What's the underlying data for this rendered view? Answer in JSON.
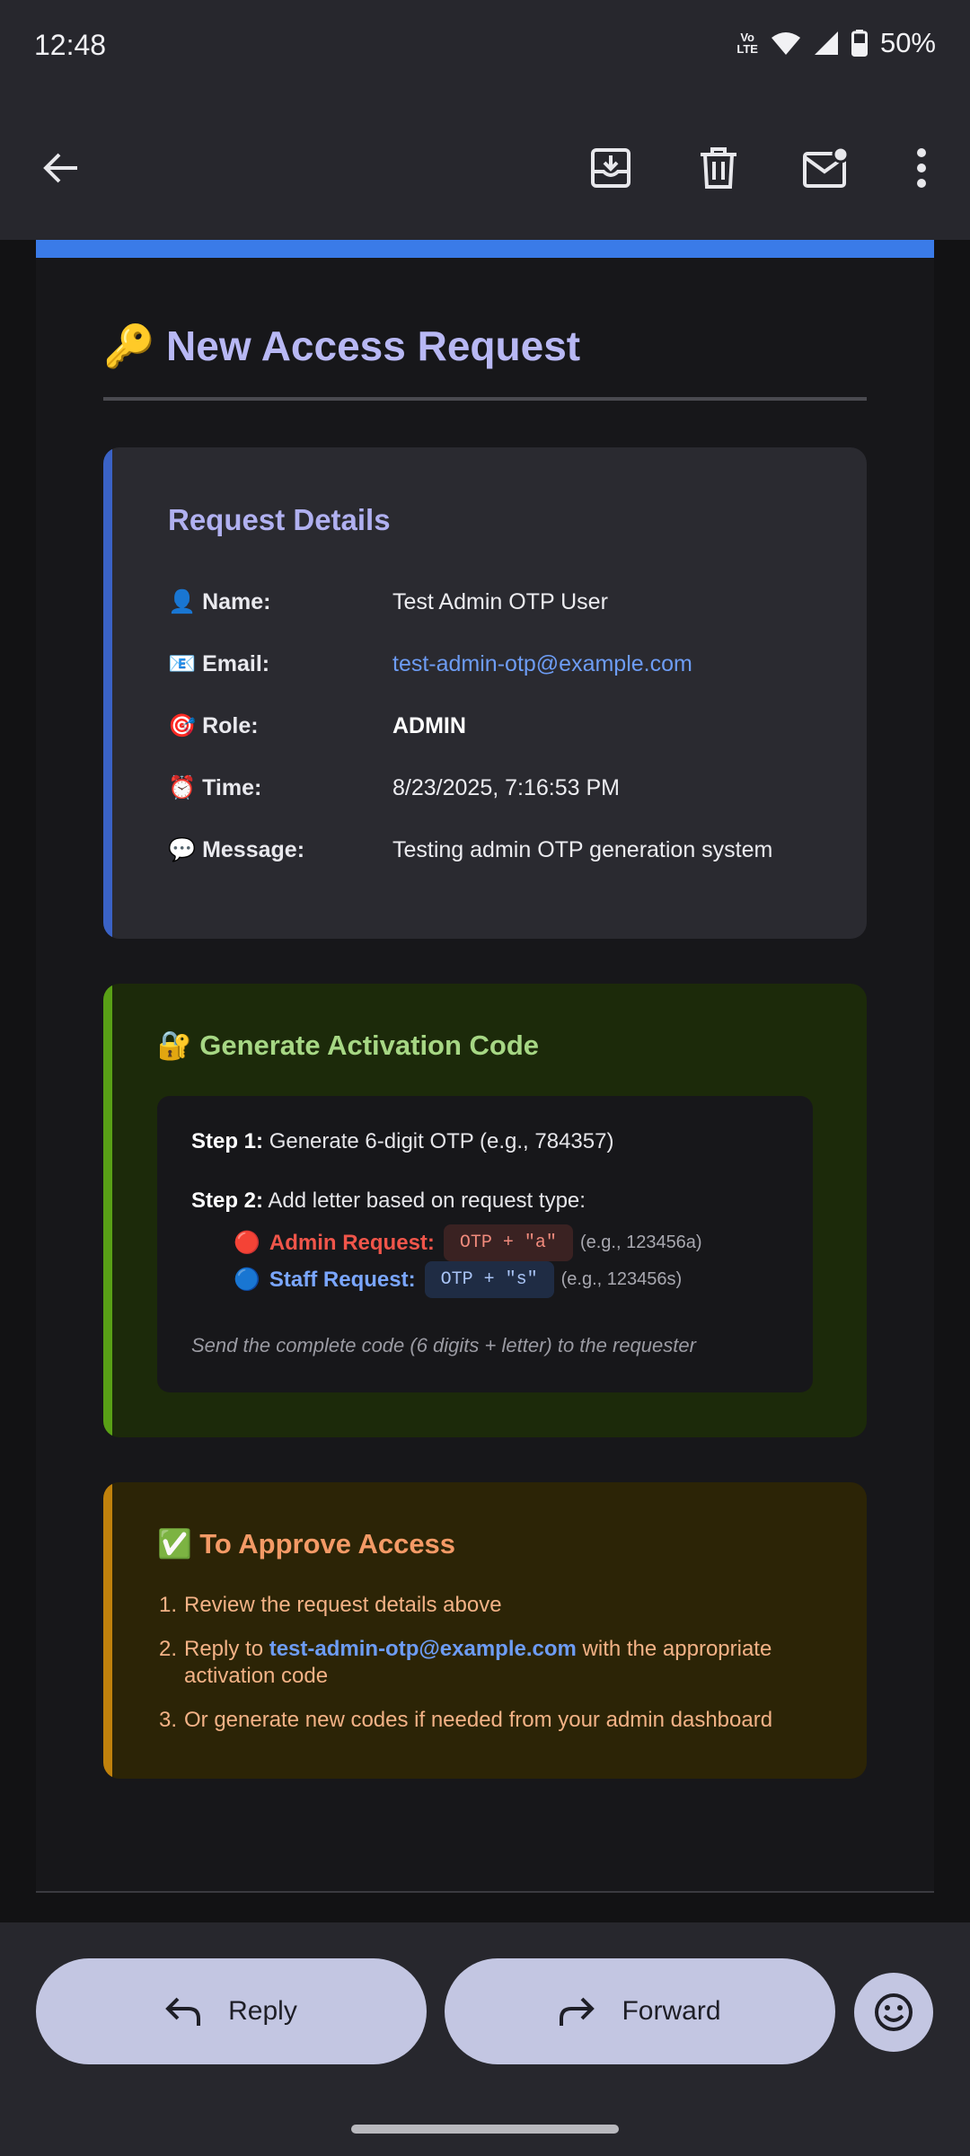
{
  "status_bar": {
    "time": "12:48",
    "volte_top": "Vo",
    "volte_bottom": "LTE",
    "battery_percent": "50%"
  },
  "app_bar": {
    "icons": [
      "back-arrow-icon",
      "archive-icon",
      "delete-icon",
      "mark-unread-icon",
      "more-vert-icon"
    ]
  },
  "email": {
    "title": "🔑 New Access Request",
    "details": {
      "heading": "Request Details",
      "rows": [
        {
          "label": "👤 Name:",
          "value": "Test Admin OTP User"
        },
        {
          "label": "📧 Email:",
          "value": "test-admin-otp@example.com"
        },
        {
          "label": "🎯 Role:",
          "value": "ADMIN"
        },
        {
          "label": "⏰ Time:",
          "value": "8/23/2025, 7:16:53 PM"
        },
        {
          "label": "💬 Message:",
          "value": "Testing admin OTP generation system"
        }
      ]
    },
    "activation": {
      "heading": "🔐 Generate Activation Code",
      "step1_label": "Step 1:",
      "step1_text": "Generate 6-digit OTP (e.g., 784357)",
      "step2_label": "Step 2:",
      "step2_text": "Add letter based on request type:",
      "admin": {
        "dot": "🔴",
        "label": "Admin Request:",
        "code": "OTP + \"a\"",
        "example": "(e.g., 123456a)"
      },
      "staff": {
        "dot": "🔵",
        "label": "Staff Request:",
        "code": "OTP + \"s\"",
        "example": "(e.g., 123456s)"
      },
      "note": "Send the complete code (6 digits + letter) to the requester"
    },
    "approve": {
      "heading": "✅ To Approve Access",
      "items": [
        {
          "num": "1.",
          "text": "Review the request details above"
        },
        {
          "num": "2.",
          "pre": "Reply to ",
          "email": "test-admin-otp@example.com",
          "post": " with the appropriate",
          "line2": "activation code"
        },
        {
          "num": "3.",
          "text": "Or generate new codes if needed from your admin dashboard"
        }
      ]
    }
  },
  "actions": {
    "reply_label": "Reply",
    "forward_label": "Forward"
  },
  "colors": {
    "accent_blue": "#3a7be8",
    "green_accent": "#59a016",
    "orange_accent": "#c0810c",
    "button_bg": "#c3c6e2"
  }
}
